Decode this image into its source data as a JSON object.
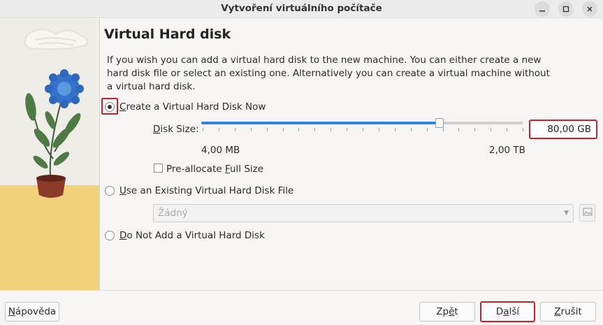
{
  "window": {
    "title": "Vytvoření virtuálního počítače",
    "minimize_icon": "minimize-icon",
    "maximize_icon": "maximize-icon",
    "close_icon": "close-icon"
  },
  "page": {
    "heading": "Virtual Hard disk",
    "description": "If you wish you can add a virtual hard disk to the new machine. You can either create a new hard disk file or select an existing one. Alternatively you can create a virtual machine without a virtual hard disk."
  },
  "options": {
    "create_new": {
      "label_prefix": "C",
      "label_rest": "reate a Virtual Hard Disk Now",
      "selected": true
    },
    "use_existing": {
      "label_prefix": "U",
      "label_rest": "se an Existing Virtual Hard Disk File",
      "selected": false
    },
    "no_disk": {
      "label_prefix": "D",
      "label_rest": "o Not Add a Virtual Hard Disk",
      "selected": false
    }
  },
  "disk_size": {
    "label_prefix": "D",
    "label_rest": "isk Size:",
    "value": "80,00 GB",
    "min_label": "4,00 MB",
    "max_label": "2,00 TB",
    "slider_fraction": 0.74
  },
  "preallocate": {
    "label_a": "Pre-allocate ",
    "label_u": "F",
    "label_b": "ull Size",
    "checked": false
  },
  "existing_file": {
    "value": "Žádný",
    "browse_icon": "folder-image-icon"
  },
  "buttons": {
    "help_u": "N",
    "help_rest": "ápověda",
    "back_prefix": "Zp",
    "back_u": "ě",
    "back_rest": "t",
    "next_prefix": "D",
    "next_u": "a",
    "next_rest": "lší",
    "cancel_u": "Z",
    "cancel_rest": "rušit"
  },
  "colors": {
    "accent": "#3584e4",
    "highlight": "#c81f2b"
  }
}
